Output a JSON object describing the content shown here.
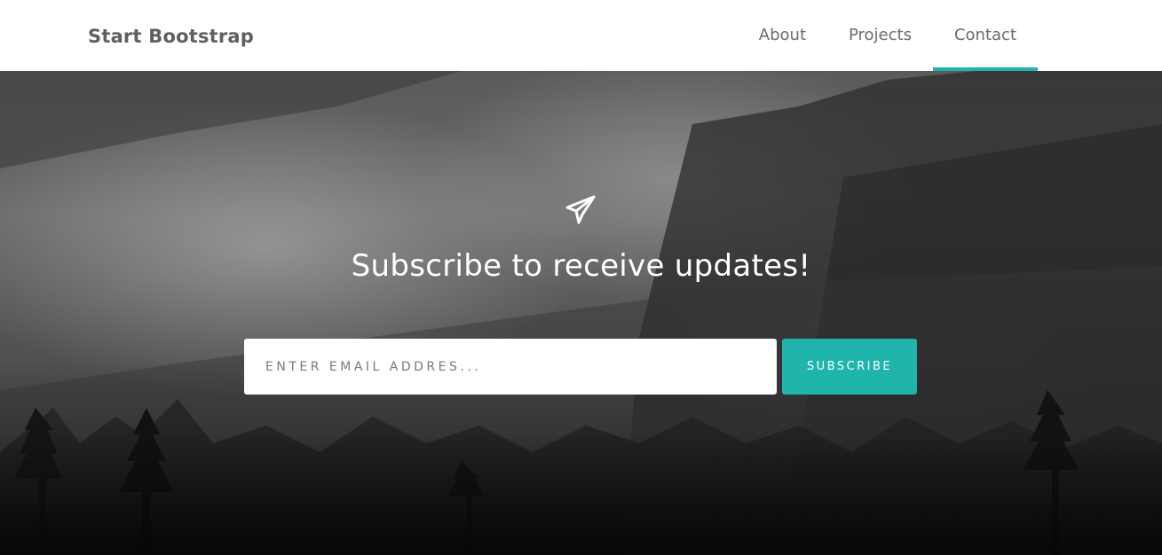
{
  "navbar": {
    "brand": "Start Bootstrap",
    "items": [
      {
        "label": "About",
        "active": false
      },
      {
        "label": "Projects",
        "active": false
      },
      {
        "label": "Contact",
        "active": true
      }
    ]
  },
  "hero": {
    "icon": "paper-plane-icon",
    "headline": "Subscribe to receive updates!",
    "email_placeholder": "ENTER EMAIL ADDRES...",
    "email_value": "",
    "subscribe_label": "SUBSCRIBE"
  },
  "colors": {
    "accent": "#1fb5ad",
    "nav_text": "#6b6b6b",
    "brand_text": "#5f5f5f",
    "navbar_bg": "#ffffff"
  }
}
